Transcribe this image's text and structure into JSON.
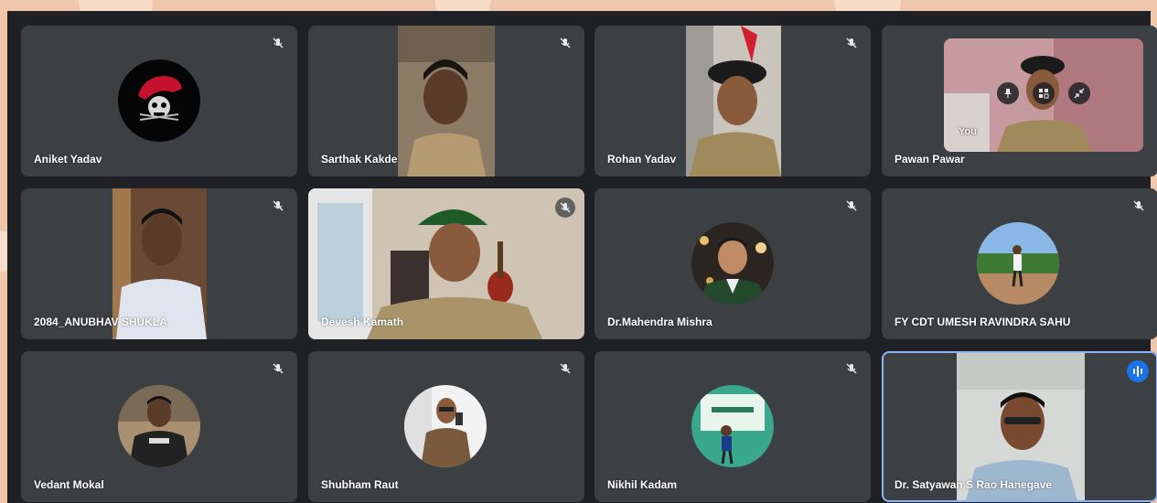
{
  "meeting": {
    "you_label": "You",
    "participants": [
      {
        "name": "Aniket Yadav"
      },
      {
        "name": "Sarthak Kakde"
      },
      {
        "name": "Rohan Yadav"
      },
      {
        "name": "Pawan Pawar"
      },
      {
        "name": "2084_ANUBHAV SHUKLA"
      },
      {
        "name": "Devesh Kamath"
      },
      {
        "name": "Dr.Mahendra Mishra"
      },
      {
        "name": "FY CDT UMESH RAVINDRA SAHU"
      },
      {
        "name": "Vedant Mokal"
      },
      {
        "name": "Shubham Raut"
      },
      {
        "name": "Nikhil Kadam"
      },
      {
        "name": "Dr. Satyawan S Rao Hanegave"
      }
    ]
  },
  "icons": {
    "muted": "mic-off-icon",
    "speaking": "audio-level-icon",
    "pin": "pin-icon",
    "frame": "frame-icon",
    "minimize": "minimize-icon"
  },
  "colors": {
    "tile_background": "#3c4043",
    "grid_background": "#202124",
    "speaking_border": "#8ab4f8",
    "speaking_badge": "#1a73e8"
  }
}
